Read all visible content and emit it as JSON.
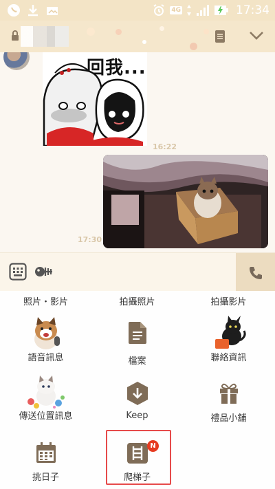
{
  "status_bar": {
    "time": "17:34",
    "network": "4G"
  },
  "chat": {
    "sticker_text": "回我...",
    "timestamps": [
      "16:22",
      "17:30"
    ]
  },
  "attachments": {
    "row0": [
      "照片・影片",
      "拍攝照片",
      "拍攝影片"
    ],
    "items": [
      {
        "label": "語音訊息",
        "icon": "cat-mic-icon"
      },
      {
        "label": "檔案",
        "icon": "file-icon"
      },
      {
        "label": "聯絡資訊",
        "icon": "black-cat-icon"
      },
      {
        "label": "傳送位置訊息",
        "icon": "cat-location-icon"
      },
      {
        "label": "Keep",
        "icon": "keep-icon"
      },
      {
        "label": "禮品小舖",
        "icon": "gift-icon"
      },
      {
        "label": "挑日子",
        "icon": "calendar-icon"
      },
      {
        "label": "爬梯子",
        "icon": "ladder-icon",
        "badge": "N"
      }
    ]
  },
  "colors": {
    "accent": "#8c7a63",
    "header_bg": "#f5e7cc",
    "badge": "#e63b21",
    "highlight": "#e64a4a"
  }
}
